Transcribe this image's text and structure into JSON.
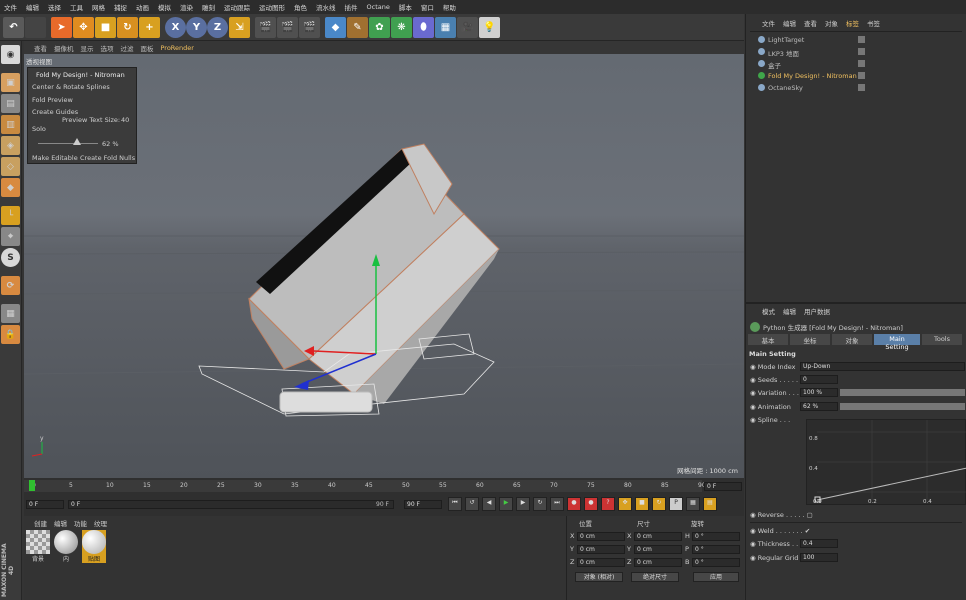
{
  "menu": [
    "文件",
    "编辑",
    "选择",
    "工具",
    "网格",
    "捕捉",
    "动画",
    "模拟",
    "渲染",
    "雕刻",
    "运动跟踪",
    "运动图形",
    "角色",
    "流水线",
    "插件",
    "Octane",
    "脚本",
    "窗口",
    "帮助"
  ],
  "toolbar": {
    "x": "X",
    "y": "Y",
    "z": "Z"
  },
  "viewport_menu": [
    "查看",
    "摄像机",
    "显示",
    "选项",
    "过滤",
    "面板",
    "ProRender"
  ],
  "viewport_title": "透视视图",
  "grid_label": "网格间距 : 1000 cm",
  "fold_panel": {
    "title": "Fold My Design! - Nitroman",
    "center": "Center & Rotate Splines",
    "preview": "Fold Preview",
    "guides": "Create Guides",
    "text_size_label": "Preview Text Size:",
    "text_size": "40",
    "solo": "Solo",
    "slider_value": "62 %",
    "make_editable": "Make Editable",
    "create_nulls": "Create Fold Nulls"
  },
  "objects_menu": [
    "文件",
    "编辑",
    "查看",
    "对象",
    "标签",
    "书签"
  ],
  "objects": [
    "LightTarget",
    "LKP3 地面",
    "盒子",
    "Fold My Design! - Nitroman",
    "OctaneSky"
  ],
  "timeline": {
    "ticks": [
      "0",
      "5",
      "10",
      "15",
      "20",
      "25",
      "30",
      "35",
      "40",
      "45",
      "50",
      "55",
      "60",
      "65",
      "70",
      "75",
      "80",
      "85",
      "90"
    ],
    "frame_end": "0 F",
    "start": "0 F",
    "cur": "0 F",
    "end_a": "90 F",
    "end_b": "90 F"
  },
  "material": {
    "tabs": [
      "创建",
      "编辑",
      "功能",
      "纹理"
    ],
    "items": [
      "背景",
      "内",
      "贴图"
    ]
  },
  "coords": {
    "headers": [
      "位置",
      "尺寸",
      "旋转"
    ],
    "rows": [
      {
        "a": "X",
        "p": "0 cm",
        "b": "X",
        "s": "0 cm",
        "c": "H",
        "r": "0 °"
      },
      {
        "a": "Y",
        "p": "0 cm",
        "b": "Y",
        "s": "0 cm",
        "c": "P",
        "r": "0 °"
      },
      {
        "a": "Z",
        "p": "0 cm",
        "b": "Z",
        "s": "0 cm",
        "c": "B",
        "r": "0 °"
      }
    ],
    "mode": "对象 (相对)",
    "size_mode": "绝对尺寸",
    "apply": "应用"
  },
  "attr": {
    "menu": [
      "模式",
      "编辑",
      "用户数据"
    ],
    "title": "Python 生成器 [Fold My Design! - Nitroman]",
    "tabs": [
      "基本",
      "坐标",
      "对象",
      "Main Setting",
      "Tools"
    ],
    "section": "Main Setting",
    "mode_label": "Mode Index",
    "mode_value": "Up-Down",
    "seeds_label": "Seeds",
    "seeds_value": "0",
    "variation_label": "Variation",
    "variation_value": "100 %",
    "animation_label": "Animation",
    "animation_value": "62 %",
    "spline_label": "Spline",
    "curve_y": [
      "0.8",
      "0.4"
    ],
    "curve_x": [
      "0.0",
      "0.2",
      "0.4"
    ],
    "reverse": "Reverse",
    "weld": "Weld",
    "thickness_label": "Thickness",
    "thickness_value": "0.4",
    "grid_label": "Regular Grid",
    "grid_value": "100"
  },
  "brand": "MAXON CINEMA 4D",
  "colors": {
    "accent": "#f0a020",
    "highlight_tab": "#5a7fa8",
    "ui_bg": "#343434"
  }
}
